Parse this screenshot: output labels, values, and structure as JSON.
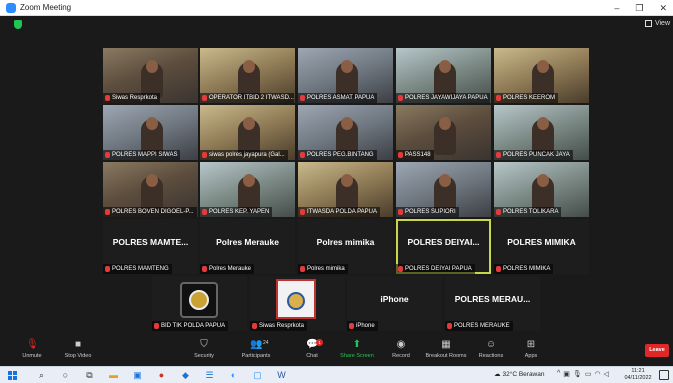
{
  "window": {
    "title": "Zoom Meeting",
    "minimize": "–",
    "restore": "❐",
    "close": "✕"
  },
  "topbar": {
    "view_label": "View"
  },
  "tiles": [
    {
      "name": "Siwas Resprkota",
      "kind": "video",
      "style": "video"
    },
    {
      "name": "OPERATOR ITBID 2 ITWASD...",
      "kind": "video",
      "style": "video alt2"
    },
    {
      "name": "POLRES ASMAT PAPUA",
      "kind": "video",
      "style": "video alt1"
    },
    {
      "name": "POLRES JAYAWIJAYA PAPUA",
      "kind": "video",
      "style": "video alt3"
    },
    {
      "name": "POLRES KEEROM",
      "kind": "video",
      "style": "video alt2"
    },
    {
      "name": "POLRES MAPPI SIWAS",
      "kind": "video",
      "style": "video alt1"
    },
    {
      "name": "siwas polres jayapura (Gal...",
      "kind": "video",
      "style": "video alt2"
    },
    {
      "name": "POLRES PEG.BINTANG",
      "kind": "video",
      "style": "video alt1"
    },
    {
      "name": "PASS148",
      "kind": "video",
      "style": "video"
    },
    {
      "name": "POLRES PUNCAK JAYA",
      "kind": "video",
      "style": "video alt3"
    },
    {
      "name": "POLRES BOVEN DIGOEL-P...",
      "kind": "video",
      "style": "video"
    },
    {
      "name": "POLRES KEP. YAPEN",
      "kind": "video",
      "style": "video alt3"
    },
    {
      "name": "ITWASDA POLDA PAPUA",
      "kind": "video",
      "style": "video alt2"
    },
    {
      "name": "POLRES SUPIORI",
      "kind": "video",
      "style": "video alt1"
    },
    {
      "name": "POLRES TOLIKARA",
      "kind": "video",
      "style": "video alt3"
    },
    {
      "name": "POLRES MAMTENG",
      "kind": "name",
      "big": "POLRES MAMTE..."
    },
    {
      "name": "Polres Merauke",
      "kind": "name",
      "big": "Polres Merauke"
    },
    {
      "name": "Polres mimika",
      "kind": "name",
      "big": "Polres mimika"
    },
    {
      "name": "POLRES DEIYAI PAPUA",
      "kind": "name",
      "big": "POLRES DEIYAI...",
      "active": true
    },
    {
      "name": "POLRES MIMIKA",
      "kind": "name",
      "big": "POLRES MIMIKA"
    },
    {
      "name": "BID TIK POLDA PAPUA",
      "kind": "logo",
      "logo_text": "TIK POLRI"
    },
    {
      "name": "Siwas Resprkota",
      "kind": "logo2",
      "logo_text": "INSPEKTORAT"
    },
    {
      "name": "iPhone",
      "kind": "name",
      "big": "iPhone"
    },
    {
      "name": "POLRES MERAUKE",
      "kind": "name",
      "big": "POLRES MERAU..."
    }
  ],
  "toolbar": {
    "unmute": "Unmute",
    "stop_video": "Stop Video",
    "security": "Security",
    "participants": "Participants",
    "participants_count": "24",
    "chat": "Chat",
    "chat_badge": "1",
    "share_screen": "Share Screen",
    "record": "Record",
    "breakout": "Breakout Rooms",
    "reactions": "Reactions",
    "apps": "Apps",
    "leave": "Leave"
  },
  "taskbar": {
    "weather": "32°C Berawan",
    "time": "11:21",
    "date": "04/11/2022"
  }
}
